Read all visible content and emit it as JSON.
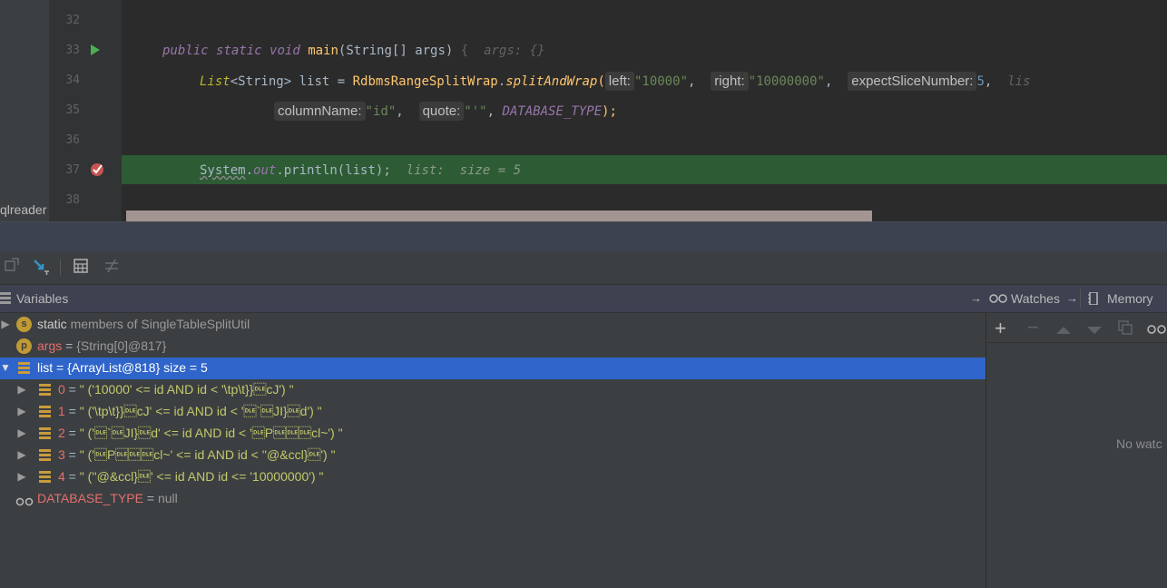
{
  "editor": {
    "side_label": "qlreader",
    "line_numbers": [
      "32",
      "33",
      "34",
      "35",
      "36",
      "37",
      "38"
    ],
    "line33": {
      "kw1": "public ",
      "kw2": "static ",
      "kw3": "void ",
      "method": "main",
      "open": "(",
      "type": "String[] ",
      "arg": "args",
      "close": ") ",
      "brace": "{",
      "hint": "  args: {}"
    },
    "line34": {
      "decl": "List",
      "generic": "<String>",
      "var": " list = ",
      "cls": "RdbmsRangeSplitWrap",
      "dot": ".",
      "call": "splitAndWrap",
      "paren": "(",
      "p1": "left:",
      "v1": "\"10000\"",
      "c1": ", ",
      "p2": "right:",
      "v2": "\"10000000\"",
      "c2": ", ",
      "p3": "expectSliceNumber:",
      "v3": "5",
      "c3": ",  ",
      "tail": "lis"
    },
    "line35": {
      "p4": "columnName:",
      "v4": "\"id\"",
      "c4": ", ",
      "p5": "quote:",
      "v5": "\"'\"",
      "c5": ", ",
      "const": "DATABASE_TYPE",
      "end": ");"
    },
    "line37": {
      "cls": "System",
      "dot1": ".",
      "field": "out",
      "dot2": ".",
      "method": "println",
      "args": "(list);",
      "hint": "  list:  size = 5"
    }
  },
  "toolbar": {
    "icons": [
      "drop-frame-icon",
      "force-step-into-icon",
      "evaluate-expression-icon",
      "trace-stream-icon"
    ]
  },
  "panel": {
    "variables_label": "Variables",
    "watches_label": "Watches",
    "memory_label": "Memory"
  },
  "variables": {
    "static": {
      "badge": "s",
      "name": "static",
      "desc": " members of SingleTableSplitUtil"
    },
    "args": {
      "badge": "p",
      "name": "args",
      "eq": " = ",
      "ref": "{String[0]@817}"
    },
    "list": {
      "name": "list",
      "eq": " = ",
      "ref": "{ArrayList@818}",
      "size": "  size = 5"
    },
    "items": [
      {
        "index": "0",
        "eq": " = ",
        "value": "\" ('10000' <= id AND id < '\\tp\\t}}\u0010cJ') \""
      },
      {
        "index": "1",
        "eq": " = ",
        "value": "\" ('\\tp\\t}}\u0010cJ' <= id AND id < '\u0010`\u0010JI}\u0010d') \""
      },
      {
        "index": "2",
        "eq": " = ",
        "value": "\" ('\u0010`\u0010JI}\u0010d' <= id AND id < '\u0010P\u0010\u0010\u0010cl~') \""
      },
      {
        "index": "3",
        "eq": " = ",
        "value": "\" ('\u0010P\u0010\u0010\u0010cl~' <= id AND id < ''@&ccl}\u0010') \""
      },
      {
        "index": "4",
        "eq": " = ",
        "value": "\" (''@&ccl}\u0010' <= id AND id <= '10000000') \""
      }
    ],
    "database_type": {
      "name": "DATABASE_TYPE",
      "eq": " = ",
      "value": "null"
    }
  },
  "watches": {
    "empty_text": "No watc"
  },
  "colors": {
    "exec_line": "#2d5b34",
    "selection": "#2f65ca",
    "badge": "#c09a34"
  }
}
